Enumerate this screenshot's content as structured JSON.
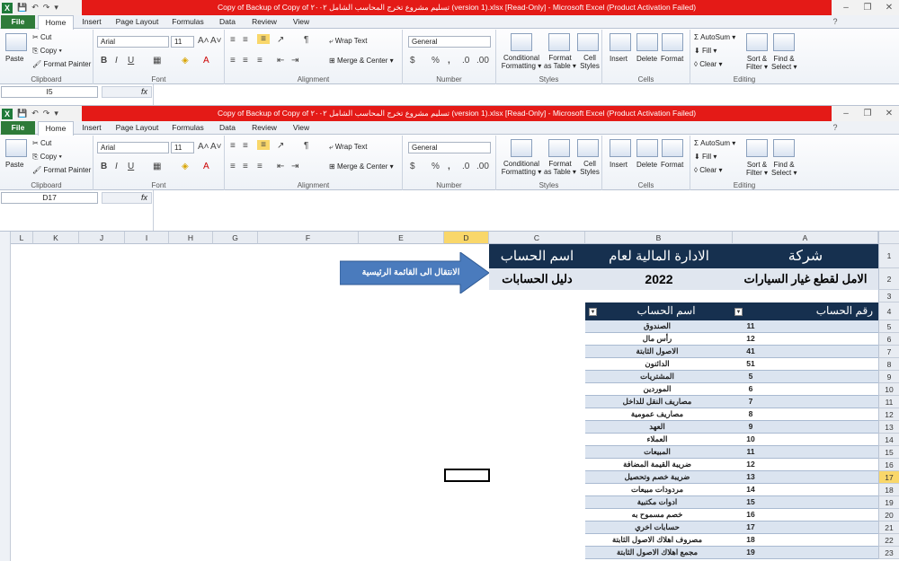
{
  "window": {
    "title": "Copy of Backup of Copy of تسليم مشروع تخرج المحاسب الشامل ٢٠٠٢ (version 1).xlsx  [Read-Only]  -  Microsoft Excel (Product Activation Failed)",
    "title2": "Copy of Backup of Copy of تسليم مشروع تخرج المحاسب الشامل ٢٠٠٢ (version 1).xlsx  [Read-Only]  -  Microsoft Excel (Product Activation Failed)"
  },
  "tabs": [
    "File",
    "Home",
    "Insert",
    "Page Layout",
    "Formulas",
    "Data",
    "Review",
    "View"
  ],
  "ribbon": {
    "clipboard": {
      "paste": "Paste",
      "cut": "Cut",
      "copy": "Copy",
      "format_painter": "Format Painter",
      "label": "Clipboard"
    },
    "font": {
      "name": "Arial",
      "size": "11",
      "label": "Font"
    },
    "alignment": {
      "wrap": "Wrap Text",
      "merge": "Merge & Center",
      "label": "Alignment"
    },
    "number": {
      "format": "General",
      "label": "Number"
    },
    "styles": {
      "conditional": "Conditional",
      "formatting": "Formatting",
      "format_as": "Format",
      "as_table": "as Table",
      "cell": "Cell",
      "styles_word": "Styles",
      "label": "Styles"
    },
    "cells": {
      "insert": "Insert",
      "delete": "Delete",
      "format": "Format",
      "label": "Cells"
    },
    "editing": {
      "autosum": "AutoSum",
      "fill": "Fill",
      "clear": "Clear",
      "sort": "Sort &",
      "filter": "Filter",
      "find": "Find &",
      "select": "Select",
      "label": "Editing"
    }
  },
  "namebox1": "I5",
  "namebox2": "D17",
  "fx": "fx",
  "columns": [
    "L",
    "K",
    "J",
    "I",
    "H",
    "G",
    "F",
    "E",
    "D",
    "C",
    "B",
    "A"
  ],
  "rows": [
    "1",
    "2",
    "3",
    "4",
    "5",
    "6",
    "7",
    "8",
    "9",
    "10",
    "11",
    "12",
    "13",
    "14",
    "15",
    "16",
    "17",
    "18",
    "19",
    "20",
    "21",
    "22",
    "23"
  ],
  "header": {
    "company": "شركة",
    "admin": "الادارة المالية لعام",
    "account_name": "اسم الحساب",
    "company_name": "الامل لقطع غيار السيارات",
    "year": "2022",
    "guide": "دليل الحسابات"
  },
  "nav_button": "الانتقال الى القائمة الرئيسية",
  "table": {
    "col_number": "رقم الحساب",
    "col_name": "اسم الحساب",
    "rows": [
      {
        "num": "11",
        "name": "الصندوق"
      },
      {
        "num": "12",
        "name": "رأس مال"
      },
      {
        "num": "41",
        "name": "الاصول الثابتة"
      },
      {
        "num": "51",
        "name": "الدائنون"
      },
      {
        "num": "5",
        "name": "المشتريات"
      },
      {
        "num": "6",
        "name": "الموردين"
      },
      {
        "num": "7",
        "name": "مصاريف النقل للداخل"
      },
      {
        "num": "8",
        "name": "مصاريف عمومية"
      },
      {
        "num": "9",
        "name": "العهد"
      },
      {
        "num": "10",
        "name": "العملاء"
      },
      {
        "num": "11",
        "name": "المبيعات"
      },
      {
        "num": "12",
        "name": "ضريبة القيمة المضافة"
      },
      {
        "num": "13",
        "name": "ضريبة خصم وتحصيل"
      },
      {
        "num": "14",
        "name": "مردودات مبيعات"
      },
      {
        "num": "15",
        "name": "ادوات مكتبية"
      },
      {
        "num": "16",
        "name": "خصم مسموح به"
      },
      {
        "num": "17",
        "name": "حسابات اخري"
      },
      {
        "num": "18",
        "name": "مصروف اهلاك الاصول الثابتة"
      },
      {
        "num": "19",
        "name": "مجمع اهلاك الاصول الثابتة"
      }
    ]
  }
}
